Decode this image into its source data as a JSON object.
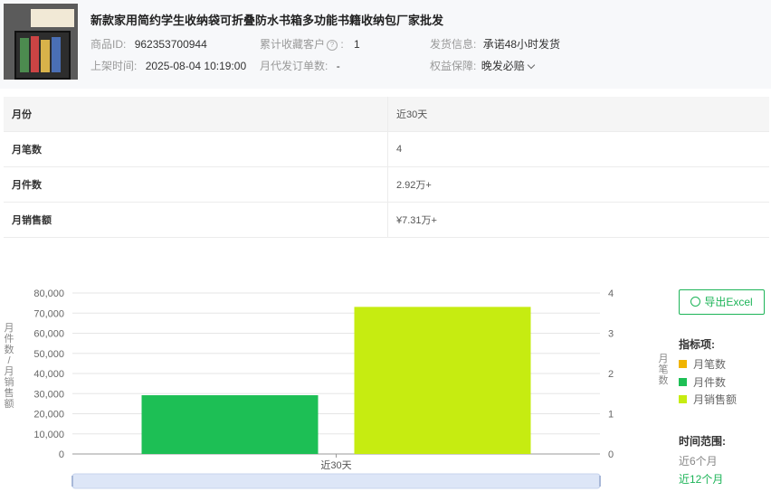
{
  "product": {
    "title": "新款家用简约学生收纳袋可折叠防水书箱多功能书籍收纳包厂家批发",
    "id_label": "商品ID:",
    "id_value": "962353700944",
    "collect_label": "累计收藏客户",
    "collect_value": "1",
    "ship_label": "发货信息:",
    "ship_value": "承诺48小时发货",
    "listed_label": "上架时间:",
    "listed_value": "2025-08-04 10:19:00",
    "monthly_orders_label": "月代发订单数:",
    "monthly_orders_value": "-",
    "guarantee_label": "权益保障:",
    "guarantee_value": "晚发必赔"
  },
  "table": {
    "header": [
      "月份",
      "近30天"
    ],
    "rows": [
      [
        "月笔数",
        "4"
      ],
      [
        "月件数",
        "2.92万+"
      ],
      [
        "月销售额",
        "¥7.31万+"
      ]
    ]
  },
  "chart_data": {
    "type": "bar",
    "categories": [
      "近30天"
    ],
    "series": [
      {
        "name": "月笔数",
        "values": [
          4
        ],
        "axis": "right",
        "color": "#f0b400"
      },
      {
        "name": "月件数",
        "values": [
          29200
        ],
        "axis": "left",
        "color": "#1dbf55"
      },
      {
        "name": "月销售额",
        "values": [
          73100
        ],
        "axis": "left",
        "color": "#c6ec11"
      }
    ],
    "ylabel_left": "月件数/月销售额",
    "ylabel_right": "月笔数",
    "ylim_left": [
      0,
      80000
    ],
    "ylim_right": [
      0,
      4
    ],
    "yticks_left": [
      "80,000",
      "70,000",
      "60,000",
      "50,000",
      "40,000",
      "30,000",
      "20,000",
      "10,000",
      "0"
    ],
    "yticks_right": [
      "4",
      "3",
      "2",
      "1",
      "0"
    ],
    "grid": true,
    "legend_position": "right"
  },
  "sidebar": {
    "export_label": "导出Excel",
    "legend_title": "指标项:",
    "range_title": "时间范围:",
    "range_options": [
      "近6个月",
      "近12个月"
    ],
    "range_active": "近12个月"
  }
}
